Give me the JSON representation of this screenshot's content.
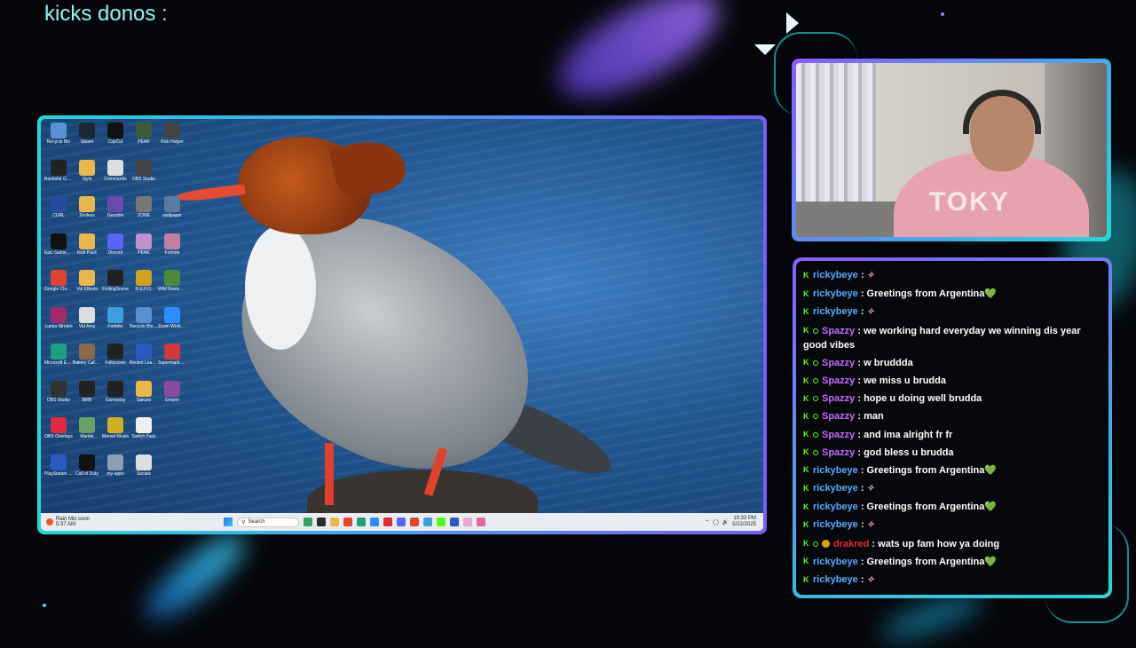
{
  "overlay": {
    "donos_text": "kicks donos :"
  },
  "desktop": {
    "icons": [
      {
        "label": "Recycle Bin",
        "icon": "recycle-bin-icon",
        "color": "#5a8fd4"
      },
      {
        "label": "Steam",
        "icon": "steam-icon",
        "color": "#1b2838"
      },
      {
        "label": "CapCut",
        "icon": "capcut-icon",
        "color": "#111111"
      },
      {
        "label": "PEAK",
        "icon": "game-icon",
        "color": "#3c5a3c"
      },
      {
        "label": "Kick Helper",
        "icon": "app-icon",
        "color": "#444444"
      },
      {
        "label": "Rockstar Games Launcher",
        "icon": "rockstar-icon",
        "color": "#222222"
      },
      {
        "label": "Stylo",
        "icon": "folder-icon",
        "color": "#e8b84a"
      },
      {
        "label": "Commands",
        "icon": "app-icon",
        "color": "#dddddd"
      },
      {
        "label": "OBS Studio",
        "icon": "obs-icon",
        "color": "#444444"
      },
      {
        "label": "",
        "icon": "blank-icon",
        "color": "transparent"
      },
      {
        "label": "CURL",
        "icon": "app-icon",
        "color": "#2a4aa0"
      },
      {
        "label": "Zenless",
        "icon": "folder-icon",
        "color": "#e8b84a"
      },
      {
        "label": "Genshin",
        "icon": "game-icon",
        "color": "#6a4ab0"
      },
      {
        "label": "ZONE",
        "icon": "game-icon",
        "color": "#777777"
      },
      {
        "label": "wallpaper",
        "icon": "image-icon",
        "color": "#5a7aa0"
      },
      {
        "label": "Epic Games Launcher",
        "icon": "epic-icon",
        "color": "#111111"
      },
      {
        "label": "Kick Pack",
        "icon": "folder-icon",
        "color": "#e8b84a"
      },
      {
        "label": "Discord",
        "icon": "discord-icon",
        "color": "#5865f2"
      },
      {
        "label": "PEAK",
        "icon": "game-icon",
        "color": "#c090d0"
      },
      {
        "label": "Fortnite",
        "icon": "game-icon",
        "color": "#c080a0"
      },
      {
        "label": "Google Chrome",
        "icon": "chrome-icon",
        "color": "#dd4433"
      },
      {
        "label": "Vid Effects",
        "icon": "folder-icon",
        "color": "#e8b84a"
      },
      {
        "label": "EndingScene",
        "icon": "obs-icon",
        "color": "#222222"
      },
      {
        "label": "R.E.P.O.",
        "icon": "game-icon",
        "color": "#d0a020"
      },
      {
        "label": "Wild Roots Chef's",
        "icon": "game-icon",
        "color": "#4a8a3a"
      },
      {
        "label": "Lumia Stream",
        "icon": "lumia-icon",
        "color": "#a02a6a"
      },
      {
        "label": "Vid Ama",
        "icon": "app-icon",
        "color": "#dddddd"
      },
      {
        "label": "Fortnite",
        "icon": "file-icon",
        "color": "#3aa0e0"
      },
      {
        "label": "Recycle Bin Shortcut",
        "icon": "recycle-bin-icon",
        "color": "#5a8fd4"
      },
      {
        "label": "Zoom Workplace",
        "icon": "zoom-icon",
        "color": "#2d8cff"
      },
      {
        "label": "Microsoft Edge",
        "icon": "edge-icon",
        "color": "#1f9e80"
      },
      {
        "label": "Bakery Cafe Simulator",
        "icon": "game-icon",
        "color": "#8a6a4a"
      },
      {
        "label": "Fullscreen",
        "icon": "obs-icon",
        "color": "#222222"
      },
      {
        "label": "Rocket League",
        "icon": "game-icon",
        "color": "#2a5ac0"
      },
      {
        "label": "Supermarket Together",
        "icon": "game-icon",
        "color": "#d03a3a"
      },
      {
        "label": "OBS Studio",
        "icon": "obs-icon",
        "color": "#333333"
      },
      {
        "label": "BRB",
        "icon": "obs-icon",
        "color": "#222222"
      },
      {
        "label": "Gameplay",
        "icon": "obs-icon",
        "color": "#222222"
      },
      {
        "label": "Sakura",
        "icon": "folder-icon",
        "color": "#e8b84a"
      },
      {
        "label": "Empire",
        "icon": "game-icon",
        "color": "#8a4aa0"
      },
      {
        "label": "OBS Overlays",
        "icon": "app-icon",
        "color": "#e02a3a"
      },
      {
        "label": "Marble",
        "icon": "game-icon",
        "color": "#6aa060"
      },
      {
        "label": "Marvel Rivals",
        "icon": "game-icon",
        "color": "#d0b020"
      },
      {
        "label": "Switch Pack",
        "icon": "file-icon",
        "color": "#eeeeee"
      },
      {
        "label": "",
        "icon": "blank-icon",
        "color": "transparent"
      },
      {
        "label": "PlayStation Accessories",
        "icon": "playstation-icon",
        "color": "#2a5ac0"
      },
      {
        "label": "Call of Duty",
        "icon": "cod-icon",
        "color": "#111111"
      },
      {
        "label": "my-apps",
        "icon": "image-icon",
        "color": "#8aa0b0"
      },
      {
        "label": "Socials",
        "icon": "app-icon",
        "color": "#dddddd"
      },
      {
        "label": "",
        "icon": "blank-icon",
        "color": "transparent"
      }
    ],
    "taskbar": {
      "weather_title": "Rain Mix soon",
      "weather_sub": "5:37 AM",
      "search_placeholder": "Search",
      "apps": [
        "#3aa060",
        "#2b2b2b",
        "#e8b84a",
        "#e04a2a",
        "#1f9e80",
        "#2d8cff",
        "#e02a3a",
        "#5865f2",
        "#dd4433",
        "#3aa0e0",
        "#53fc18",
        "#2a5ac0",
        "#e6a9d6",
        "#e06aa0"
      ],
      "time": "10:33 PM",
      "date": "5/22/2025"
    }
  },
  "chat": {
    "messages": [
      {
        "user": "rickybeye",
        "user_style": "user",
        "badges": [
          "kick"
        ],
        "text": "",
        "emote": "emote"
      },
      {
        "user": "rickybeye",
        "user_style": "user",
        "badges": [
          "kick"
        ],
        "text": "Greetings from Argentina",
        "heart": "💚"
      },
      {
        "user": "rickybeye",
        "user_style": "user",
        "badges": [
          "kick"
        ],
        "text": "",
        "emote": "emote"
      },
      {
        "user": "Spazzy",
        "user_style": "u-spazzy",
        "badges": [
          "kick",
          "dot"
        ],
        "text": "we working hard everyday we winning dis year good vibes"
      },
      {
        "user": "Spazzy",
        "user_style": "u-spazzy",
        "badges": [
          "kick",
          "dot"
        ],
        "text": "w bruddda"
      },
      {
        "user": "Spazzy",
        "user_style": "u-spazzy",
        "badges": [
          "kick",
          "dot"
        ],
        "text": "we miss u brudda"
      },
      {
        "user": "Spazzy",
        "user_style": "u-spazzy",
        "badges": [
          "kick",
          "dot"
        ],
        "text": "hope u doing well brudda"
      },
      {
        "user": "Spazzy",
        "user_style": "u-spazzy",
        "badges": [
          "kick",
          "dot"
        ],
        "text": "man"
      },
      {
        "user": "Spazzy",
        "user_style": "u-spazzy",
        "badges": [
          "kick",
          "dot"
        ],
        "text": "and ima alright fr fr"
      },
      {
        "user": "Spazzy",
        "user_style": "u-spazzy",
        "badges": [
          "kick",
          "dot"
        ],
        "text": "god bless u brudda"
      },
      {
        "user": "rickybeye",
        "user_style": "user",
        "badges": [
          "kick"
        ],
        "text": "Greetings from Argentina",
        "heart": "💚"
      },
      {
        "user": "rickybeye",
        "user_style": "user",
        "badges": [
          "kick"
        ],
        "text": "",
        "emote": "emote"
      },
      {
        "user": "rickybeye",
        "user_style": "user",
        "badges": [
          "kick"
        ],
        "text": "Greetings from Argentina",
        "heart": "💚"
      },
      {
        "user": "rickybeye",
        "user_style": "user",
        "badges": [
          "kick"
        ],
        "text": "",
        "emote": "emote"
      },
      {
        "user": "drakred",
        "user_style": "u-drakred",
        "badges": [
          "kick",
          "dot",
          "gold"
        ],
        "text": "wats up fam how ya doing"
      },
      {
        "user": "rickybeye",
        "user_style": "user",
        "badges": [
          "kick"
        ],
        "text": "Greetings from Argentina",
        "heart": "💚"
      },
      {
        "user": "rickybeye",
        "user_style": "user",
        "badges": [
          "kick"
        ],
        "text": "",
        "emote": "emote"
      }
    ]
  },
  "colors": {
    "accent_cyan": "#22d8d8",
    "accent_purple": "#8a5cff",
    "kick_green": "#53fc18"
  }
}
